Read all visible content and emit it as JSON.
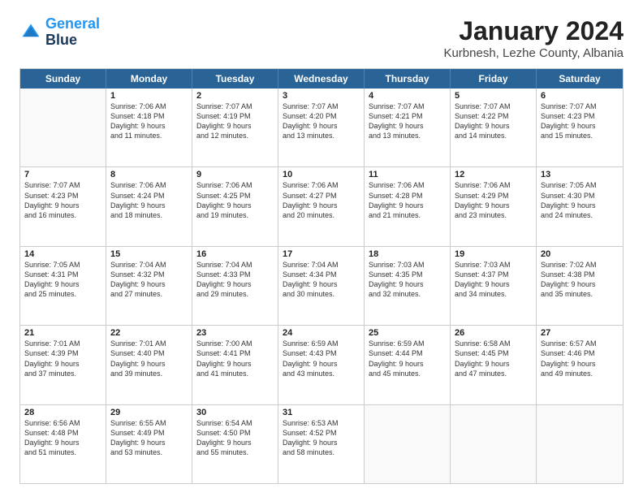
{
  "logo": {
    "line1": "General",
    "line2": "Blue"
  },
  "title": "January 2024",
  "subtitle": "Kurbnesh, Lezhe County, Albania",
  "header_days": [
    "Sunday",
    "Monday",
    "Tuesday",
    "Wednesday",
    "Thursday",
    "Friday",
    "Saturday"
  ],
  "weeks": [
    [
      {
        "day": "",
        "info": ""
      },
      {
        "day": "1",
        "info": "Sunrise: 7:06 AM\nSunset: 4:18 PM\nDaylight: 9 hours\nand 11 minutes."
      },
      {
        "day": "2",
        "info": "Sunrise: 7:07 AM\nSunset: 4:19 PM\nDaylight: 9 hours\nand 12 minutes."
      },
      {
        "day": "3",
        "info": "Sunrise: 7:07 AM\nSunset: 4:20 PM\nDaylight: 9 hours\nand 13 minutes."
      },
      {
        "day": "4",
        "info": "Sunrise: 7:07 AM\nSunset: 4:21 PM\nDaylight: 9 hours\nand 13 minutes."
      },
      {
        "day": "5",
        "info": "Sunrise: 7:07 AM\nSunset: 4:22 PM\nDaylight: 9 hours\nand 14 minutes."
      },
      {
        "day": "6",
        "info": "Sunrise: 7:07 AM\nSunset: 4:23 PM\nDaylight: 9 hours\nand 15 minutes."
      }
    ],
    [
      {
        "day": "7",
        "info": "Sunrise: 7:07 AM\nSunset: 4:23 PM\nDaylight: 9 hours\nand 16 minutes."
      },
      {
        "day": "8",
        "info": "Sunrise: 7:06 AM\nSunset: 4:24 PM\nDaylight: 9 hours\nand 18 minutes."
      },
      {
        "day": "9",
        "info": "Sunrise: 7:06 AM\nSunset: 4:25 PM\nDaylight: 9 hours\nand 19 minutes."
      },
      {
        "day": "10",
        "info": "Sunrise: 7:06 AM\nSunset: 4:27 PM\nDaylight: 9 hours\nand 20 minutes."
      },
      {
        "day": "11",
        "info": "Sunrise: 7:06 AM\nSunset: 4:28 PM\nDaylight: 9 hours\nand 21 minutes."
      },
      {
        "day": "12",
        "info": "Sunrise: 7:06 AM\nSunset: 4:29 PM\nDaylight: 9 hours\nand 23 minutes."
      },
      {
        "day": "13",
        "info": "Sunrise: 7:05 AM\nSunset: 4:30 PM\nDaylight: 9 hours\nand 24 minutes."
      }
    ],
    [
      {
        "day": "14",
        "info": "Sunrise: 7:05 AM\nSunset: 4:31 PM\nDaylight: 9 hours\nand 25 minutes."
      },
      {
        "day": "15",
        "info": "Sunrise: 7:04 AM\nSunset: 4:32 PM\nDaylight: 9 hours\nand 27 minutes."
      },
      {
        "day": "16",
        "info": "Sunrise: 7:04 AM\nSunset: 4:33 PM\nDaylight: 9 hours\nand 29 minutes."
      },
      {
        "day": "17",
        "info": "Sunrise: 7:04 AM\nSunset: 4:34 PM\nDaylight: 9 hours\nand 30 minutes."
      },
      {
        "day": "18",
        "info": "Sunrise: 7:03 AM\nSunset: 4:35 PM\nDaylight: 9 hours\nand 32 minutes."
      },
      {
        "day": "19",
        "info": "Sunrise: 7:03 AM\nSunset: 4:37 PM\nDaylight: 9 hours\nand 34 minutes."
      },
      {
        "day": "20",
        "info": "Sunrise: 7:02 AM\nSunset: 4:38 PM\nDaylight: 9 hours\nand 35 minutes."
      }
    ],
    [
      {
        "day": "21",
        "info": "Sunrise: 7:01 AM\nSunset: 4:39 PM\nDaylight: 9 hours\nand 37 minutes."
      },
      {
        "day": "22",
        "info": "Sunrise: 7:01 AM\nSunset: 4:40 PM\nDaylight: 9 hours\nand 39 minutes."
      },
      {
        "day": "23",
        "info": "Sunrise: 7:00 AM\nSunset: 4:41 PM\nDaylight: 9 hours\nand 41 minutes."
      },
      {
        "day": "24",
        "info": "Sunrise: 6:59 AM\nSunset: 4:43 PM\nDaylight: 9 hours\nand 43 minutes."
      },
      {
        "day": "25",
        "info": "Sunrise: 6:59 AM\nSunset: 4:44 PM\nDaylight: 9 hours\nand 45 minutes."
      },
      {
        "day": "26",
        "info": "Sunrise: 6:58 AM\nSunset: 4:45 PM\nDaylight: 9 hours\nand 47 minutes."
      },
      {
        "day": "27",
        "info": "Sunrise: 6:57 AM\nSunset: 4:46 PM\nDaylight: 9 hours\nand 49 minutes."
      }
    ],
    [
      {
        "day": "28",
        "info": "Sunrise: 6:56 AM\nSunset: 4:48 PM\nDaylight: 9 hours\nand 51 minutes."
      },
      {
        "day": "29",
        "info": "Sunrise: 6:55 AM\nSunset: 4:49 PM\nDaylight: 9 hours\nand 53 minutes."
      },
      {
        "day": "30",
        "info": "Sunrise: 6:54 AM\nSunset: 4:50 PM\nDaylight: 9 hours\nand 55 minutes."
      },
      {
        "day": "31",
        "info": "Sunrise: 6:53 AM\nSunset: 4:52 PM\nDaylight: 9 hours\nand 58 minutes."
      },
      {
        "day": "",
        "info": ""
      },
      {
        "day": "",
        "info": ""
      },
      {
        "day": "",
        "info": ""
      }
    ]
  ]
}
